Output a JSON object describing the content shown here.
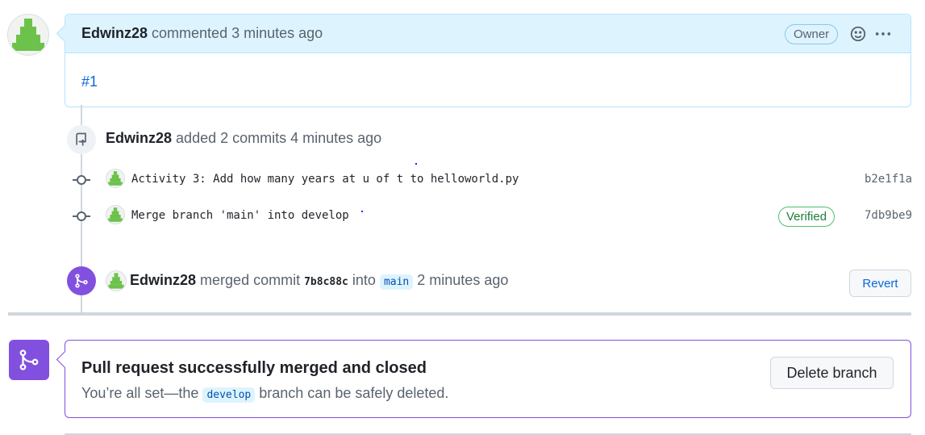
{
  "comment": {
    "author": "Edwinz28",
    "meta": "commented 3 minutes ago",
    "badge": "Owner",
    "body_link": "#1"
  },
  "commits_event": {
    "author": "Edwinz28",
    "text": "added 2 commits 4 minutes ago",
    "commits": [
      {
        "message": "Activity 3: Add how many years at u of t to helloworld.py",
        "sha": "b2e1f1a",
        "verified": ""
      },
      {
        "message": "Merge branch 'main' into develop",
        "sha": "7db9be9",
        "verified": "Verified"
      }
    ]
  },
  "merge_event": {
    "author": "Edwinz28",
    "text_a": "merged commit",
    "sha": "7b8c88c",
    "text_b": "into",
    "branch": "main",
    "text_c": "2 minutes ago",
    "revert_label": "Revert"
  },
  "merged_box": {
    "title": "Pull request successfully merged and closed",
    "sub_a": "You’re all set—the",
    "branch": "develop",
    "sub_b": "branch can be safely deleted.",
    "delete_label": "Delete branch"
  },
  "colors": {
    "accent_blue": "#0969da",
    "merged_purple": "#8250df",
    "avatar_green": "#6cc24a",
    "verified_green": "#1a7f37"
  }
}
